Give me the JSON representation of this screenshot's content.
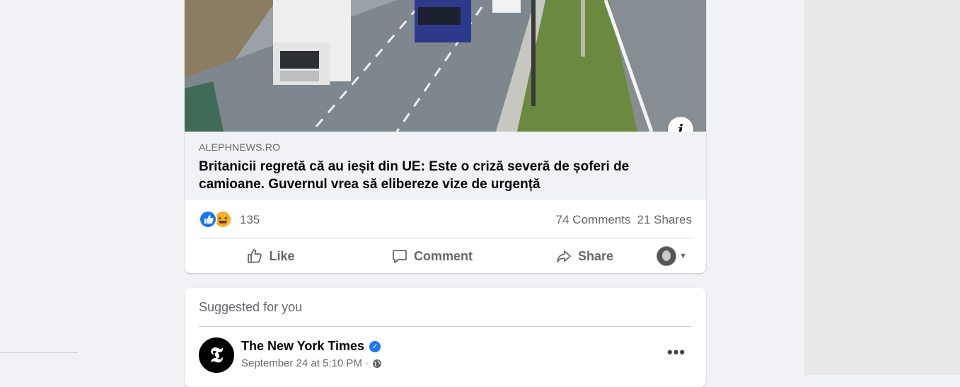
{
  "post": {
    "link": {
      "domain": "ALEPHNEWS.RO",
      "title": "Britanicii regretă că au ieșit din UE: Este o criză severă de șoferi de camioane. Guvernul vrea să elibereze vize de urgență",
      "info_icon": "info-icon"
    },
    "stats": {
      "reaction_count": "135",
      "comments": "74 Comments",
      "shares": "21 Shares",
      "reaction_icons": [
        "like-reaction-icon",
        "haha-reaction-icon"
      ]
    },
    "actions": {
      "like": "Like",
      "comment": "Comment",
      "share": "Share"
    }
  },
  "suggested": {
    "label": "Suggested for you",
    "page_name": "The New York Times",
    "page_logo": "𝕿",
    "time": "September 24 at 5:10 PM · ",
    "more": "•••"
  },
  "colors": {
    "accent": "#1877f2",
    "background": "#f0f2f5",
    "secondary_text": "#65676b"
  }
}
